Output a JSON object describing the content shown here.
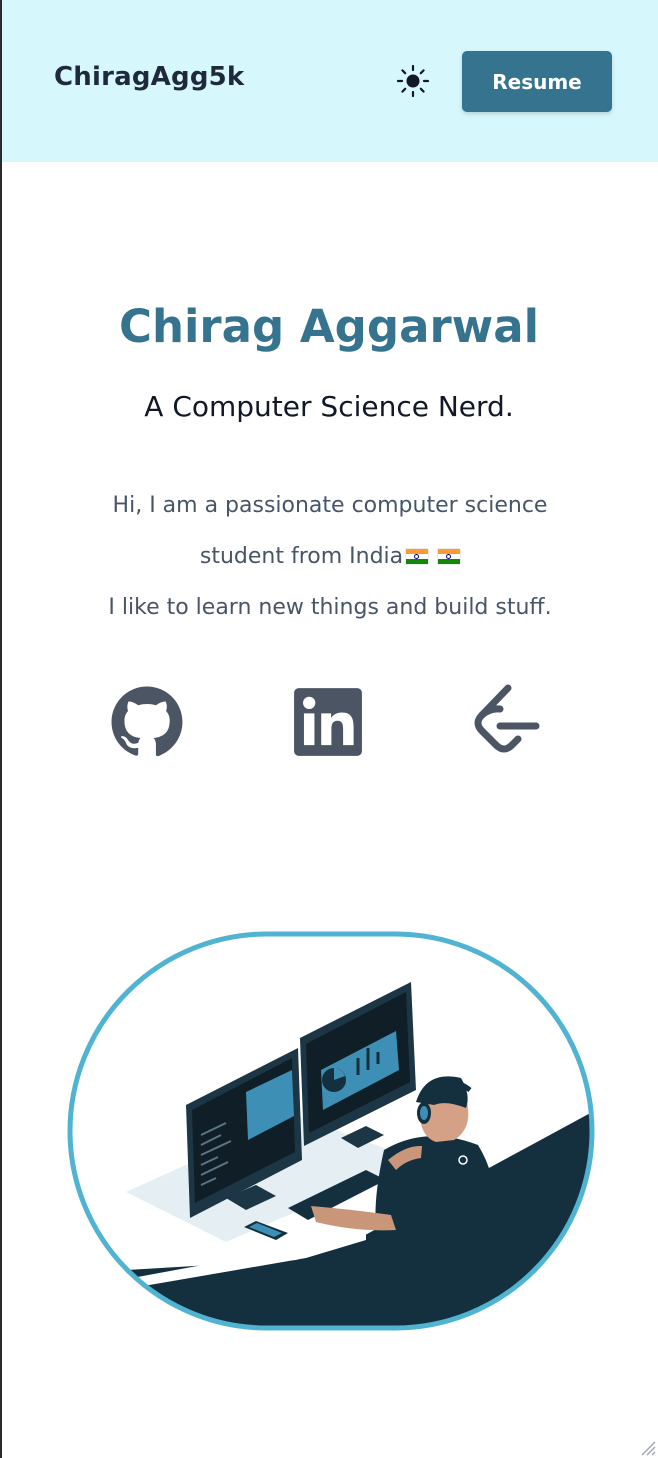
{
  "nav": {
    "brand": "ChiragAgg5k",
    "theme_icon": "sun-icon",
    "resume_label": "Resume"
  },
  "hero": {
    "name": "Chirag Aggarwal",
    "subtitle": "A Computer Science Nerd.",
    "bio": [
      "Hi, I am a passionate computer science",
      "student from India",
      "I like to learn new things and build stuff."
    ],
    "flag_icons": [
      "india-flag-icon",
      "india-flag-icon"
    ]
  },
  "social": [
    {
      "icon": "github-icon"
    },
    {
      "icon": "linkedin-icon"
    },
    {
      "icon": "leetcode-icon"
    }
  ],
  "illustration": {
    "icon": "developer-at-desk-illustration"
  },
  "colors": {
    "navbar_bg": "#d6f7fb",
    "accent": "#35738f",
    "heading_text": "#111827",
    "body_text": "#475569",
    "icon_color": "#4b5563",
    "frame_border": "#4fb3d1",
    "illustration_dark": "#14303f"
  }
}
